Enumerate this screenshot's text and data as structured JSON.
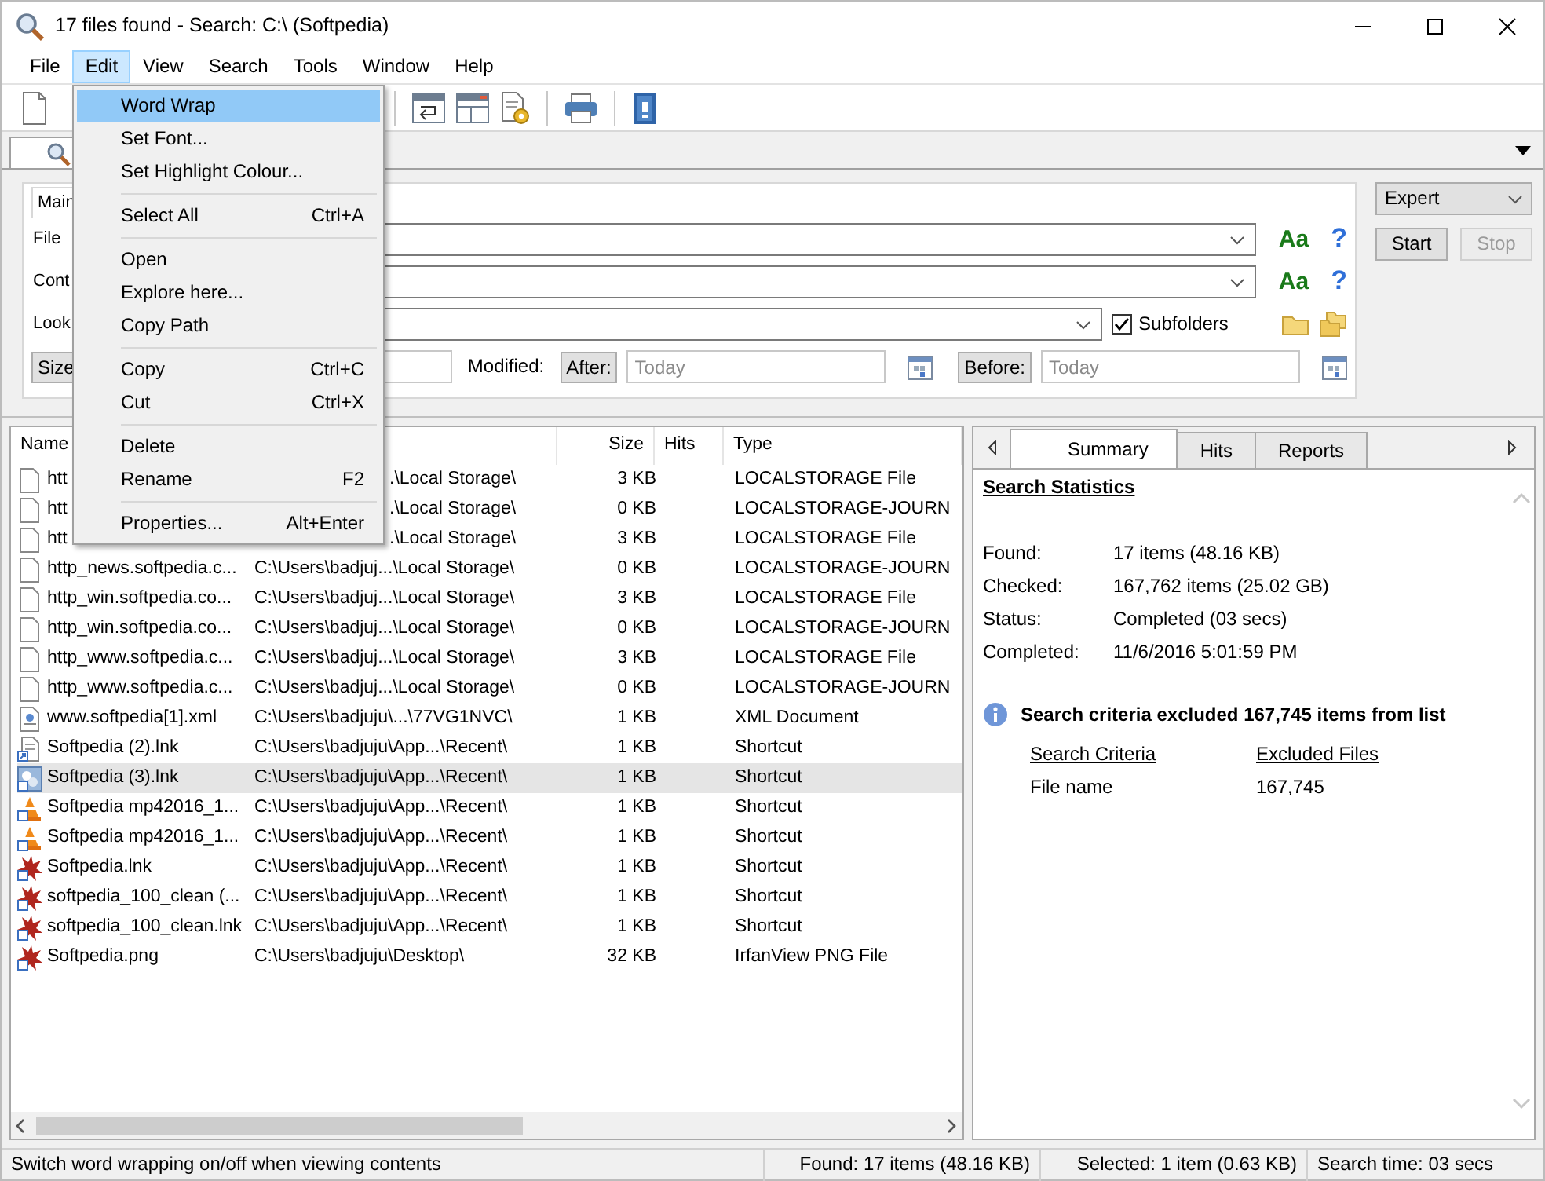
{
  "window": {
    "title": "17 files found - Search: C:\\ (Softpedia)"
  },
  "menu_bar": [
    {
      "label": "File",
      "selected": false
    },
    {
      "label": "Edit",
      "selected": true
    },
    {
      "label": "View",
      "selected": false
    },
    {
      "label": "Search",
      "selected": false
    },
    {
      "label": "Tools",
      "selected": false
    },
    {
      "label": "Window",
      "selected": false
    },
    {
      "label": "Help",
      "selected": false
    }
  ],
  "edit_menu": [
    {
      "kind": "item",
      "label": "Word Wrap",
      "selected": true
    },
    {
      "kind": "item",
      "label": "Set Font...",
      "selected": false
    },
    {
      "kind": "item",
      "label": "Set Highlight Colour...",
      "selected": false
    },
    {
      "kind": "separator"
    },
    {
      "kind": "item",
      "label": "Select All",
      "shortcut": "Ctrl+A",
      "selected": false
    },
    {
      "kind": "separator"
    },
    {
      "kind": "item",
      "label": "Open",
      "selected": false
    },
    {
      "kind": "item",
      "label": "Explore here...",
      "selected": false
    },
    {
      "kind": "item",
      "label": "Copy Path",
      "selected": false
    },
    {
      "kind": "separator"
    },
    {
      "kind": "item",
      "label": "Copy",
      "shortcut": "Ctrl+C",
      "selected": false
    },
    {
      "kind": "item",
      "label": "Cut",
      "shortcut": "Ctrl+X",
      "selected": false
    },
    {
      "kind": "separator"
    },
    {
      "kind": "item",
      "label": "Delete",
      "selected": false
    },
    {
      "kind": "item",
      "label": "Rename",
      "shortcut": "F2",
      "selected": false
    },
    {
      "kind": "separator"
    },
    {
      "kind": "item",
      "label": "Properties...",
      "shortcut": "Alt+Enter",
      "selected": false
    }
  ],
  "search_panel": {
    "tab": "Main",
    "fields": [
      {
        "label": "File",
        "match_case": "Aa",
        "help": "?"
      },
      {
        "label": "Cont",
        "match_case": "Aa",
        "help": "?"
      }
    ],
    "look_in": {
      "label": "Look",
      "subfolders": {
        "label": "Subfolders",
        "checked": true
      }
    },
    "size_button": "Size",
    "modified_label": "Modified:",
    "after_button": "After:",
    "after_placeholder": "Today",
    "before_button": "Before:",
    "before_placeholder": "Today",
    "mode": "Expert",
    "buttons": [
      {
        "label": "Start",
        "disabled": false
      },
      {
        "label": "Stop",
        "disabled": true
      }
    ]
  },
  "results": {
    "columns": [
      "Name",
      "Size",
      "Hits",
      "Type"
    ],
    "rows": [
      {
        "kind": "doc",
        "name": "htt",
        "path": ".\\Local Storage\\",
        "size": "3 KB",
        "type": "LOCALSTORAGE File",
        "selected": false,
        "covered": true
      },
      {
        "kind": "doc",
        "name": "htt",
        "path": ".\\Local Storage\\",
        "size": "0 KB",
        "type": "LOCALSTORAGE-JOURN",
        "selected": false,
        "covered": true
      },
      {
        "kind": "doc",
        "name": "htt",
        "path": ".\\Local Storage\\",
        "size": "3 KB",
        "type": "LOCALSTORAGE File",
        "selected": false,
        "covered": true
      },
      {
        "kind": "doc",
        "name": "http_news.softpedia.c...",
        "path": "C:\\Users\\badjuj...\\Local Storage\\",
        "size": "0 KB",
        "type": "LOCALSTORAGE-JOURN",
        "selected": false,
        "covered": false
      },
      {
        "kind": "doc",
        "name": "http_win.softpedia.co...",
        "path": "C:\\Users\\badjuj...\\Local Storage\\",
        "size": "3 KB",
        "type": "LOCALSTORAGE File",
        "selected": false,
        "covered": false
      },
      {
        "kind": "doc",
        "name": "http_win.softpedia.co...",
        "path": "C:\\Users\\badjuj...\\Local Storage\\",
        "size": "0 KB",
        "type": "LOCALSTORAGE-JOURN",
        "selected": false,
        "covered": false
      },
      {
        "kind": "doc",
        "name": "http_www.softpedia.c...",
        "path": "C:\\Users\\badjuj...\\Local Storage\\",
        "size": "3 KB",
        "type": "LOCALSTORAGE File",
        "selected": false,
        "covered": false
      },
      {
        "kind": "doc",
        "name": "http_www.softpedia.c...",
        "path": "C:\\Users\\badjuj...\\Local Storage\\",
        "size": "0 KB",
        "type": "LOCALSTORAGE-JOURN",
        "selected": false,
        "covered": false
      },
      {
        "kind": "xml",
        "name": "www.softpedia[1].xml",
        "path": "C:\\Users\\badjuju\\...\\77VG1NVC\\",
        "size": "1 KB",
        "type": "XML Document",
        "selected": false,
        "covered": false
      },
      {
        "kind": "shortcut",
        "name": "Softpedia (2).lnk",
        "path": "C:\\Users\\badjuju\\App...\\Recent\\",
        "size": "1 KB",
        "type": "Shortcut",
        "selected": false,
        "covered": false
      },
      {
        "kind": "app",
        "name": "Softpedia (3).lnk",
        "path": "C:\\Users\\badjuju\\App...\\Recent\\",
        "size": "1 KB",
        "type": "Shortcut",
        "selected": true,
        "covered": false
      },
      {
        "kind": "cone",
        "name": "Softpedia mp42016_1...",
        "path": "C:\\Users\\badjuju\\App...\\Recent\\",
        "size": "1 KB",
        "type": "Shortcut",
        "selected": false,
        "covered": false
      },
      {
        "kind": "cone",
        "name": "Softpedia mp42016_1...",
        "path": "C:\\Users\\badjuju\\App...\\Recent\\",
        "size": "1 KB",
        "type": "Shortcut",
        "selected": false,
        "covered": false
      },
      {
        "kind": "splat",
        "name": "Softpedia.lnk",
        "path": "C:\\Users\\badjuju\\App...\\Recent\\",
        "size": "1 KB",
        "type": "Shortcut",
        "selected": false,
        "covered": false
      },
      {
        "kind": "splat",
        "name": "softpedia_100_clean (...",
        "path": "C:\\Users\\badjuju\\App...\\Recent\\",
        "size": "1 KB",
        "type": "Shortcut",
        "selected": false,
        "covered": false
      },
      {
        "kind": "splat",
        "name": "softpedia_100_clean.lnk",
        "path": "C:\\Users\\badjuju\\App...\\Recent\\",
        "size": "1 KB",
        "type": "Shortcut",
        "selected": false,
        "covered": false
      },
      {
        "kind": "splat",
        "name": "Softpedia.png",
        "path": "C:\\Users\\badjuju\\Desktop\\",
        "size": "32 KB",
        "type": "IrfanView PNG File",
        "selected": false,
        "covered": false
      }
    ]
  },
  "details": {
    "tabs": [
      {
        "label": "Summary",
        "selected": true
      },
      {
        "label": "Hits",
        "selected": false
      },
      {
        "label": "Reports",
        "selected": false
      }
    ],
    "heading": "Search Statistics",
    "stats": [
      {
        "label": "Found:",
        "value": "17 items (48.16 KB)"
      },
      {
        "label": "Checked:",
        "value": "167,762 items (25.02 GB)"
      },
      {
        "label": "Status:",
        "value": "Completed (03 secs)"
      },
      {
        "label": "Completed:",
        "value": "11/6/2016 5:01:59 PM"
      }
    ],
    "notice": "Search criteria excluded 167,745 items from list",
    "criteria": {
      "columns": [
        "Search Criteria",
        "Excluded Files"
      ],
      "rows": [
        [
          "File name",
          "167,745"
        ]
      ]
    }
  },
  "status_bar": [
    "Switch word wrapping on/off when viewing contents",
    "Found: 17 items (48.16 KB)",
    "Selected: 1 item (0.63 KB)",
    "Search time: 03 secs"
  ]
}
